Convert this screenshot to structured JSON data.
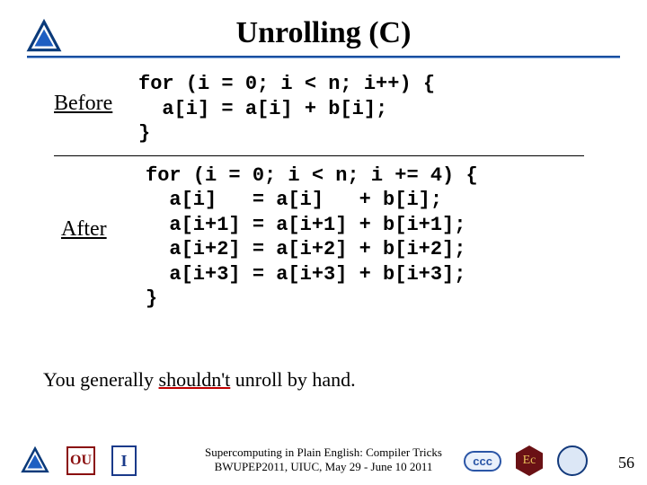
{
  "title": "Unrolling (C)",
  "before_label": "Before",
  "after_label": "After",
  "code_before": "for (i = 0; i < n; i++) {\n  a[i] = a[i] + b[i];\n}",
  "code_after": "for (i = 0; i < n; i += 4) {\n  a[i]   = a[i]   + b[i];\n  a[i+1] = a[i+1] + b[i+1];\n  a[i+2] = a[i+2] + b[i+2];\n  a[i+3] = a[i+3] + b[i+3];\n}",
  "caption_pre": "You generally ",
  "caption_underlined": "shouldn't",
  "caption_post": " unroll by hand.",
  "footer_line1": "Supercomputing in Plain English: Compiler Tricks",
  "footer_line2": "BWUPEP2011, UIUC, May 29 - June 10 2011",
  "slide_number": "56",
  "logos": {
    "ou": "OU",
    "illinois": "I",
    "ccc": "ccc",
    "ec": "Ec"
  }
}
